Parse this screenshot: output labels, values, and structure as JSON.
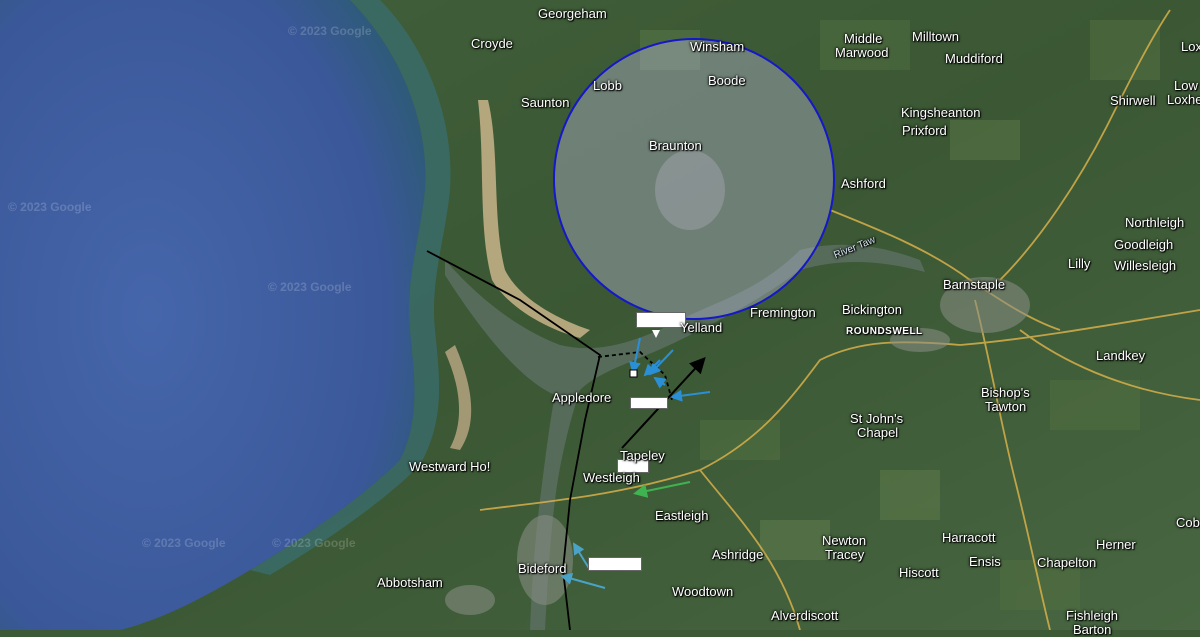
{
  "map": {
    "labels": [
      {
        "key": "georgeham",
        "text": "Georgeham"
      },
      {
        "key": "croyde",
        "text": "Croyde"
      },
      {
        "key": "saunton",
        "text": "Saunton"
      },
      {
        "key": "winsham",
        "text": "Winsham"
      },
      {
        "key": "lobb",
        "text": "Lobb"
      },
      {
        "key": "boode",
        "text": "Boode"
      },
      {
        "key": "braunton",
        "text": "Braunton"
      },
      {
        "key": "middle",
        "text": "Middle"
      },
      {
        "key": "marwood",
        "text": "Marwood"
      },
      {
        "key": "milltown",
        "text": "Milltown"
      },
      {
        "key": "muddiford",
        "text": "Muddiford"
      },
      {
        "key": "lox",
        "text": "Lox"
      },
      {
        "key": "low",
        "text": "Low"
      },
      {
        "key": "loxhe",
        "text": "Loxhe"
      },
      {
        "key": "shirwell",
        "text": "Shirwell"
      },
      {
        "key": "kingsheanton",
        "text": "Kingsheanton"
      },
      {
        "key": "prixford",
        "text": "Prixford"
      },
      {
        "key": "ashford",
        "text": "Ashford"
      },
      {
        "key": "northleigh",
        "text": "Northleigh"
      },
      {
        "key": "goodleigh",
        "text": "Goodleigh"
      },
      {
        "key": "lilly",
        "text": "Lilly"
      },
      {
        "key": "willesleigh",
        "text": "Willesleigh"
      },
      {
        "key": "river_taw",
        "text": "River Taw"
      },
      {
        "key": "barnstaple",
        "text": "Barnstaple"
      },
      {
        "key": "fremington",
        "text": "Fremington"
      },
      {
        "key": "bickington",
        "text": "Bickington"
      },
      {
        "key": "roundswell",
        "text": "ROUNDSWELL"
      },
      {
        "key": "yelland",
        "text": "Yelland"
      },
      {
        "key": "landkey",
        "text": "Landkey"
      },
      {
        "key": "bishops",
        "text": "Bishop's"
      },
      {
        "key": "tawton",
        "text": "Tawton"
      },
      {
        "key": "appledore",
        "text": "Appledore"
      },
      {
        "key": "stjohns",
        "text": "St John's"
      },
      {
        "key": "chapel",
        "text": "Chapel"
      },
      {
        "key": "tapeley",
        "text": "Tapeley"
      },
      {
        "key": "westwardho",
        "text": "Westward Ho!"
      },
      {
        "key": "westleigh",
        "text": "Westleigh"
      },
      {
        "key": "eastleigh",
        "text": "Eastleigh"
      },
      {
        "key": "harracott",
        "text": "Harracott"
      },
      {
        "key": "cob",
        "text": "Cob"
      },
      {
        "key": "newton",
        "text": "Newton"
      },
      {
        "key": "tracey",
        "text": "Tracey"
      },
      {
        "key": "herner",
        "text": "Herner"
      },
      {
        "key": "ashridge",
        "text": "Ashridge"
      },
      {
        "key": "ensis",
        "text": "Ensis"
      },
      {
        "key": "chapelton",
        "text": "Chapelton"
      },
      {
        "key": "hiscott",
        "text": "Hiscott"
      },
      {
        "key": "bideford",
        "text": "Bideford"
      },
      {
        "key": "abbotsham",
        "text": "Abbotsham"
      },
      {
        "key": "woodtown",
        "text": "Woodtown"
      },
      {
        "key": "alverdiscott",
        "text": "Alverdiscott"
      },
      {
        "key": "fishleigh",
        "text": "Fishleigh"
      },
      {
        "key": "barton",
        "text": "Barton"
      }
    ],
    "watermark": "© 2023 Google",
    "colors": {
      "sea": "#3f5ea0",
      "land": "#3c5a36",
      "circle_stroke": "#1418c8",
      "arrow_blue": "#2b8fd6",
      "arrow_green": "#3fb34f",
      "road": "#d8b04a"
    }
  }
}
